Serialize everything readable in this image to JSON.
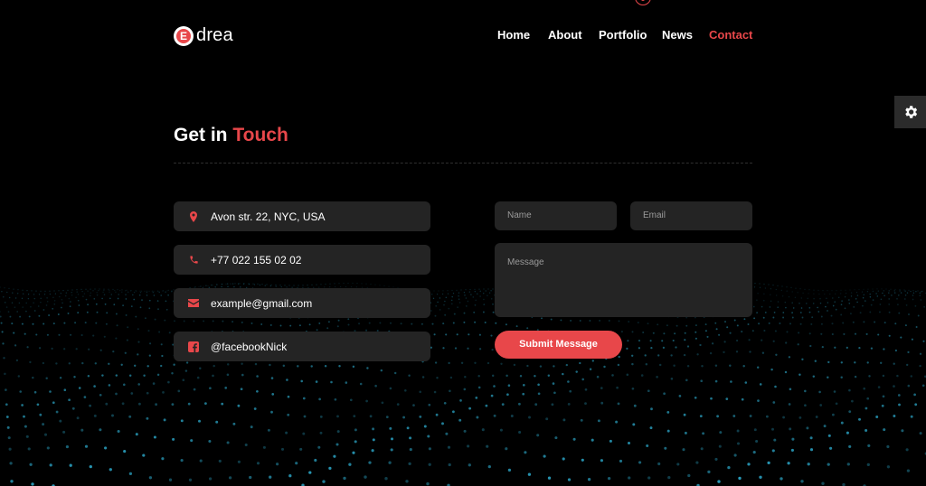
{
  "brand": {
    "logo_letter": "E",
    "name": "drea",
    "accent_color": "#e8474a"
  },
  "nav": {
    "items": [
      {
        "label": "Home"
      },
      {
        "label": "About"
      },
      {
        "label": "Portfolio"
      },
      {
        "label": "News"
      },
      {
        "label": "Contact",
        "active": true
      }
    ]
  },
  "settings": {
    "icon": "gear-icon"
  },
  "contact": {
    "heading_plain": "Get in",
    "heading_accent": "Touch",
    "info": [
      {
        "icon": "location-pin-icon",
        "text": "Avon str. 22, NYC, USA"
      },
      {
        "icon": "phone-icon",
        "text": "+77 022 155 02 02"
      },
      {
        "icon": "envelope-icon",
        "text": "example@gmail.com"
      },
      {
        "icon": "facebook-icon",
        "text": "@facebookNick"
      }
    ],
    "form": {
      "name_placeholder": "Name",
      "email_placeholder": "Email",
      "message_placeholder": "Message",
      "submit_label": "Submit Message"
    }
  },
  "background": {
    "dot_color": "#2fb4d8"
  }
}
